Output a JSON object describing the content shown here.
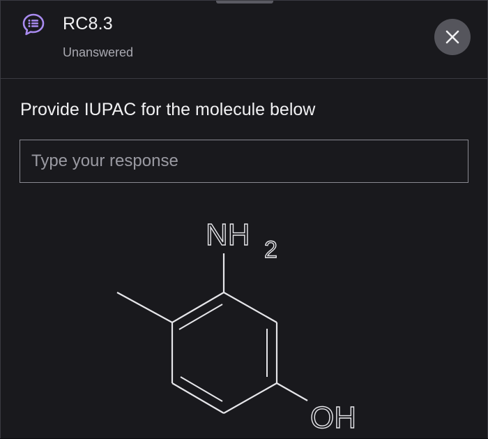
{
  "question": {
    "title": "RC8.3",
    "status": "Unanswered",
    "prompt": "Provide IUPAC for the molecule below"
  },
  "answer": {
    "placeholder": "Type your response",
    "value": ""
  },
  "molecule": {
    "amine_label": "NH",
    "amine_subscript": "2",
    "hydroxyl_label": "OH"
  },
  "icons": {
    "question": "chat-bubble-list-icon",
    "close": "close-icon"
  },
  "colors": {
    "background": "#19191d",
    "accent": "#a98bf0",
    "close_button": "#55555c"
  }
}
